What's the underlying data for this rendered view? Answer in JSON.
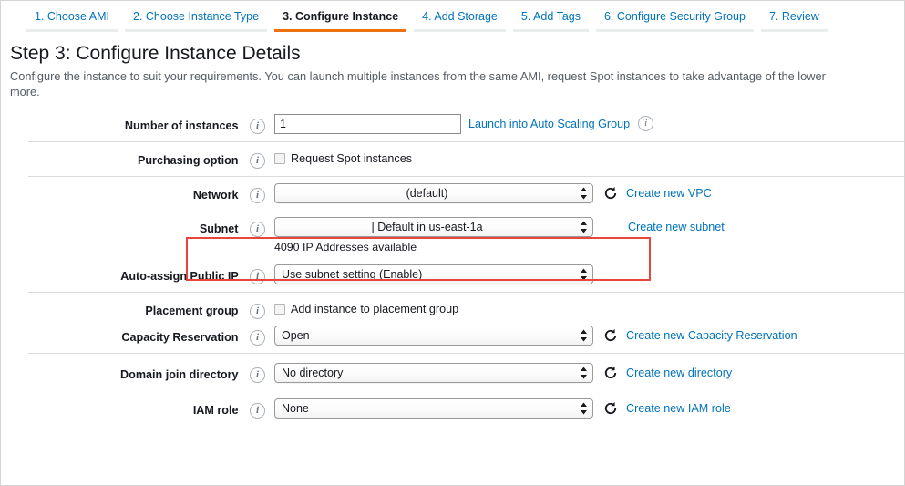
{
  "wizard": {
    "tabs": [
      {
        "label": "1. Choose AMI",
        "active": false
      },
      {
        "label": "2. Choose Instance Type",
        "active": false
      },
      {
        "label": "3. Configure Instance",
        "active": true
      },
      {
        "label": "4. Add Storage",
        "active": false
      },
      {
        "label": "5. Add Tags",
        "active": false
      },
      {
        "label": "6. Configure Security Group",
        "active": false
      },
      {
        "label": "7. Review",
        "active": false
      }
    ],
    "active_tab_color": "#ec7211",
    "link_color": "#0073bb"
  },
  "header": {
    "title": "Step 3: Configure Instance Details",
    "description": "Configure the instance to suit your requirements. You can launch multiple instances from the same AMI, request Spot instances to take advantage of the lower",
    "description_line2": "more."
  },
  "form": {
    "number_of_instances": {
      "label": "Number of instances",
      "value": "1",
      "link": "Launch into Auto Scaling Group"
    },
    "purchasing_option": {
      "label": "Purchasing option",
      "checkbox_label": "Request Spot instances",
      "checked": false
    },
    "network": {
      "label": "Network",
      "value": "(default)",
      "link": "Create new VPC"
    },
    "subnet": {
      "label": "Subnet",
      "value": "| Default in us-east-1a",
      "helper": "4090 IP Addresses available",
      "link": "Create new subnet",
      "highlight_color": "#e8453c"
    },
    "auto_assign_public_ip": {
      "label": "Auto-assign Public IP",
      "value": "Use subnet setting (Enable)"
    },
    "placement_group": {
      "label": "Placement group",
      "checkbox_label": "Add instance to placement group",
      "checked": false
    },
    "capacity_reservation": {
      "label": "Capacity Reservation",
      "value": "Open",
      "link": "Create new Capacity Reservation"
    },
    "domain_join_directory": {
      "label": "Domain join directory",
      "value": "No directory",
      "link": "Create new directory"
    },
    "iam_role": {
      "label": "IAM role",
      "value": "None",
      "link": "Create new IAM role"
    },
    "info_icon_glyph": "i"
  }
}
